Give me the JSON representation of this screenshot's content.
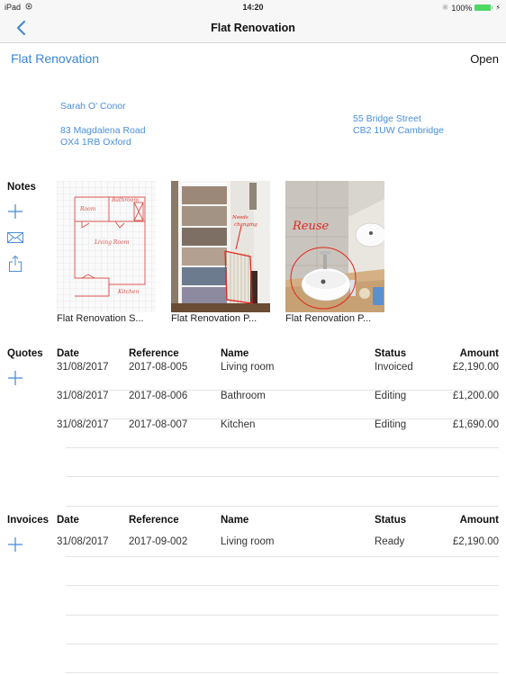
{
  "status_bar": {
    "device": "iPad",
    "time": "14:20",
    "battery": "100%",
    "battery_color": "#4cd964"
  },
  "nav": {
    "back_icon": "chevron-left-icon",
    "title": "Flat Renovation"
  },
  "project": {
    "title": "Flat Renovation",
    "status": "Open",
    "accent_color": "#3a86d8"
  },
  "client": {
    "name": "Sarah O' Conor",
    "address_line1": "83 Magdalena Road",
    "address_line2": "OX4 1RB Oxford"
  },
  "site": {
    "address_line1": "55 Bridge Street",
    "address_line2": "CB2 1UW Cambridge"
  },
  "notes": {
    "label": "Notes",
    "actions": [
      "add-icon",
      "mail-icon",
      "share-icon"
    ],
    "items": [
      {
        "caption": "Flat Renovation S...",
        "type": "floor-plan-sketch"
      },
      {
        "caption": "Flat Renovation P...",
        "type": "photo-radiator",
        "annotation": "Needs changing"
      },
      {
        "caption": "Flat Renovation P...",
        "type": "photo-sink",
        "annotation": "Reuse"
      }
    ]
  },
  "quotes": {
    "label": "Quotes",
    "columns": [
      "Date",
      "Reference",
      "Name",
      "Status",
      "Amount"
    ],
    "rows": [
      {
        "date": "31/08/2017",
        "reference": "2017-08-005",
        "name": "Living room",
        "status": "Invoiced",
        "amount": "£2,190.00"
      },
      {
        "date": "31/08/2017",
        "reference": "2017-08-006",
        "name": "Bathroom",
        "status": "Editing",
        "amount": "£1,200.00"
      },
      {
        "date": "31/08/2017",
        "reference": "2017-08-007",
        "name": "Kitchen",
        "status": "Editing",
        "amount": "£1,690.00"
      }
    ]
  },
  "invoices": {
    "label": "Invoices",
    "columns": [
      "Date",
      "Reference",
      "Name",
      "Status",
      "Amount"
    ],
    "rows": [
      {
        "date": "31/08/2017",
        "reference": "2017-09-002",
        "name": "Living room",
        "status": "Ready",
        "amount": "£2,190.00"
      }
    ]
  }
}
